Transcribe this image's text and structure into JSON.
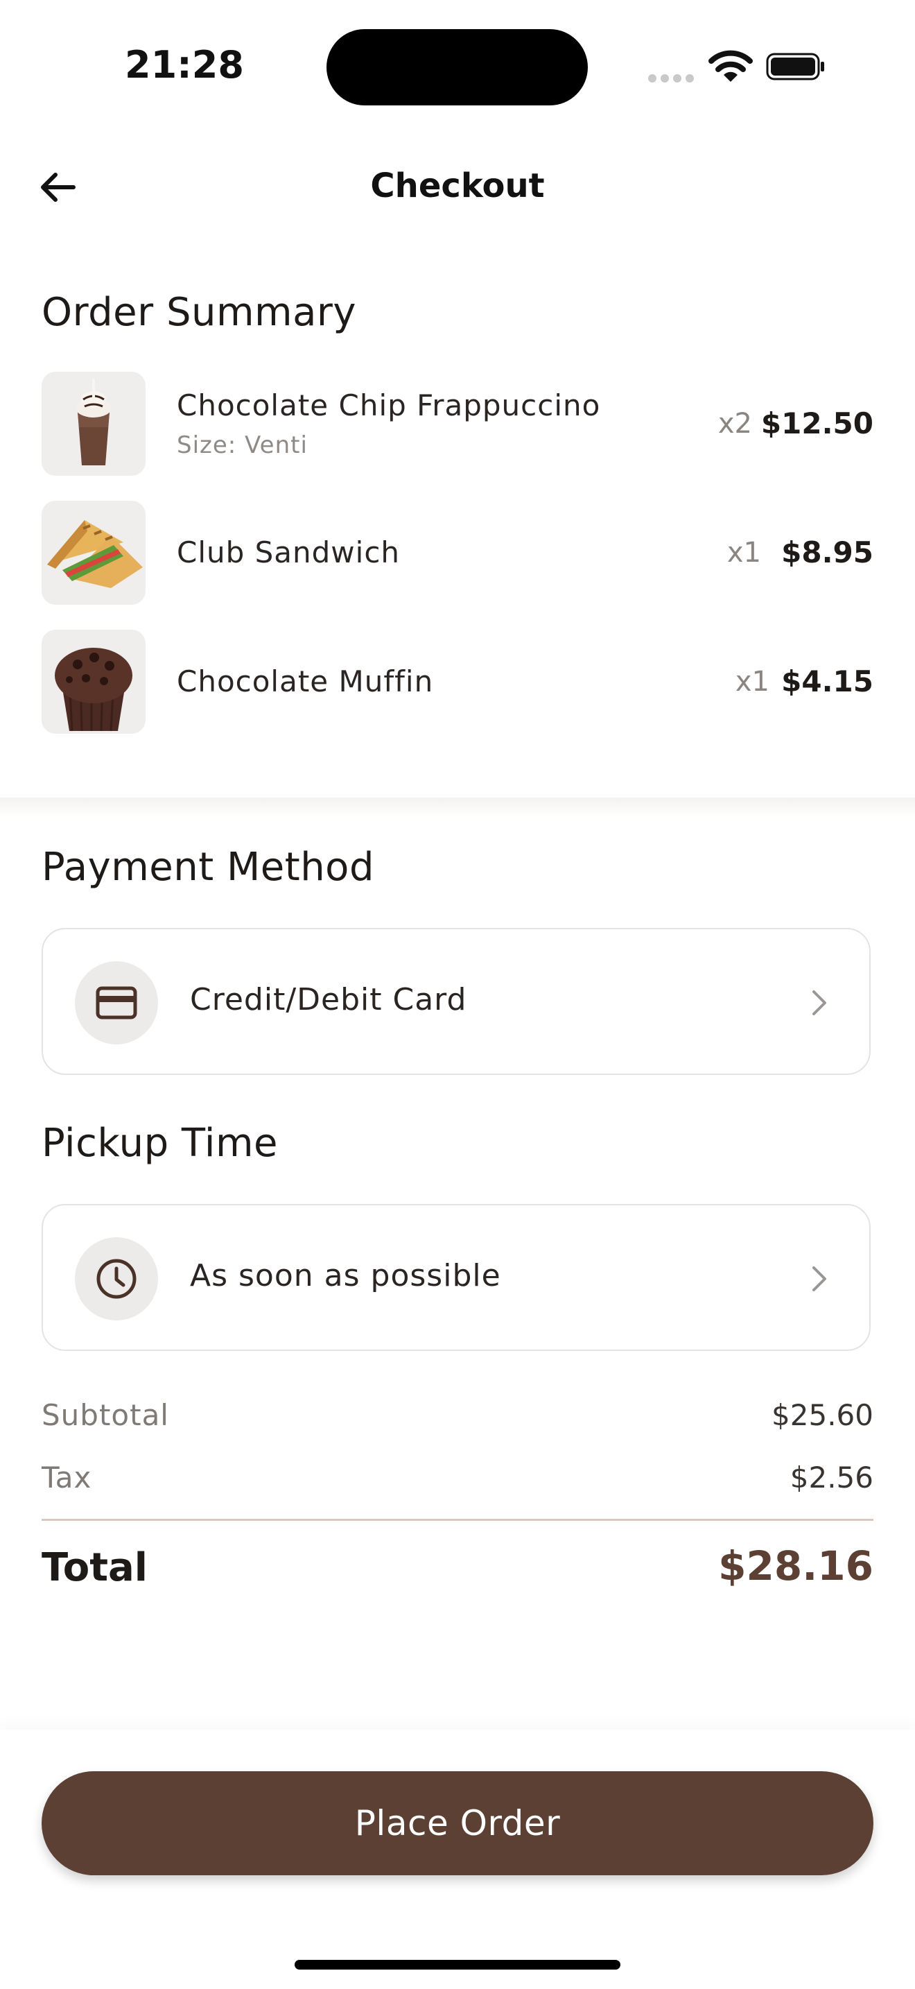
{
  "status_bar": {
    "time": "21:28"
  },
  "header": {
    "title": "Checkout"
  },
  "order_summary": {
    "heading": "Order Summary",
    "items": [
      {
        "name": "Chocolate Chip Frappuccino",
        "detail": "Size: Venti",
        "qty": "x2",
        "price": "$12.50",
        "image": "frappuccino-image"
      },
      {
        "name": "Club Sandwich",
        "qty": "x1",
        "price": "$8.95",
        "image": "sandwich-image"
      },
      {
        "name": "Chocolate Muffin",
        "qty": "x1",
        "price": "$4.15",
        "image": "muffin-image"
      }
    ]
  },
  "payment": {
    "heading": "Payment Method",
    "label": "Credit/Debit Card",
    "icon": "credit-card-icon"
  },
  "pickup": {
    "heading": "Pickup Time",
    "label": "As soon as possible",
    "icon": "clock-icon"
  },
  "totals": {
    "subtotal_label": "Subtotal",
    "subtotal": "$25.60",
    "tax_label": "Tax",
    "tax": "$2.56",
    "total_label": "Total",
    "total": "$28.16"
  },
  "actions": {
    "place_order": "Place Order"
  },
  "colors": {
    "accent": "#5c4033",
    "card_border": "#e6e4e2",
    "icon_bg": "#ecebea"
  }
}
